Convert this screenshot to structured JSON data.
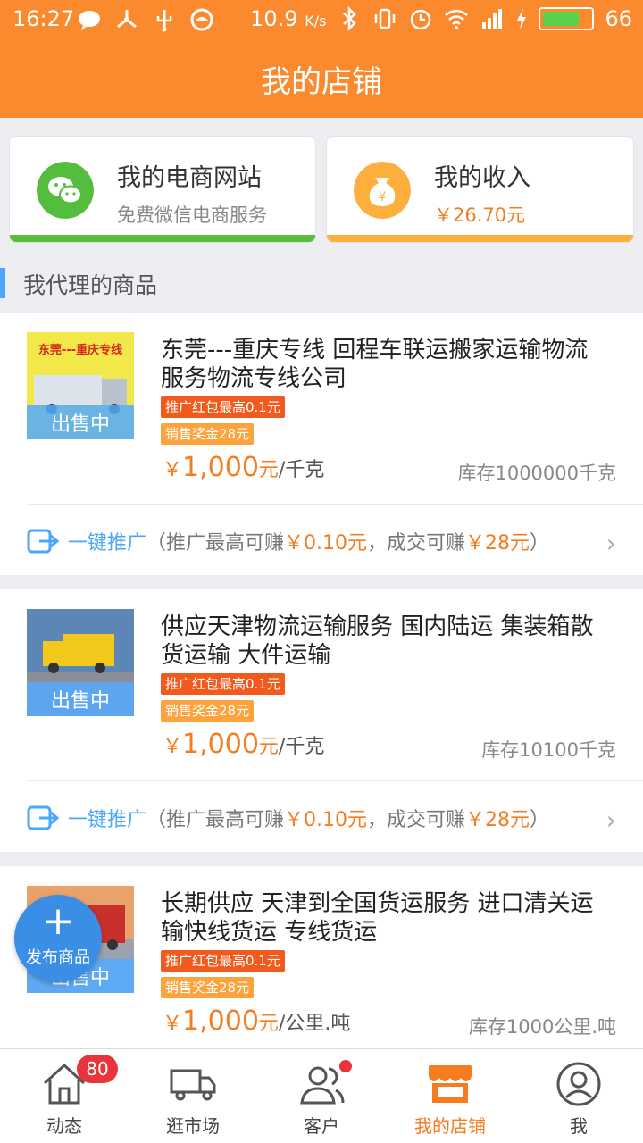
{
  "statusbar": {
    "time": "16:27",
    "speed": "10.9",
    "speed_unit": "K/s",
    "battery": "66"
  },
  "title": "我的店铺",
  "cards": {
    "site": {
      "title": "我的电商网站",
      "subtitle": "免费微信电商服务",
      "accent": "#55bd3e"
    },
    "income": {
      "title": "我的收入",
      "subtitle": "￥26.70元",
      "accent": "#fdae3c"
    }
  },
  "section_title": "我代理的商品",
  "products": [
    {
      "name": "东莞---重庆专线 回程车联运搬家运输物流服务物流专线公司",
      "thumb_text": "东莞---重庆专线",
      "status": "出售中",
      "tag_redpacket": "推广红包最高0.1元",
      "tag_bonus": "销售奖金28元",
      "price_symbol": "￥",
      "price": "1,000",
      "price_suffix": "元",
      "price_unit": "/千克",
      "stock": "库存1000000千克",
      "promo_label": "一键推广",
      "promo_text_a": "（推广最高可赚",
      "promo_amount_a": "￥0.10元",
      "promo_text_b": "，成交可赚",
      "promo_amount_b": "￥28元",
      "promo_text_c": "）"
    },
    {
      "name": "供应天津物流运输服务 国内陆运 集装箱散货运输 大件运输",
      "thumb_text": "",
      "status": "出售中",
      "tag_redpacket": "推广红包最高0.1元",
      "tag_bonus": "销售奖金28元",
      "price_symbol": "￥",
      "price": "1,000",
      "price_suffix": "元",
      "price_unit": "/千克",
      "stock": "库存10100千克",
      "promo_label": "一键推广",
      "promo_text_a": "（推广最高可赚",
      "promo_amount_a": "￥0.10元",
      "promo_text_b": "，成交可赚",
      "promo_amount_b": "￥28元",
      "promo_text_c": "）"
    },
    {
      "name": "长期供应 天津到全国货运服务 进口清关运输快线货运 专线货运",
      "thumb_text": "",
      "status": "出售中",
      "tag_redpacket": "推广红包最高0.1元",
      "tag_bonus": "销售奖金28元",
      "price_symbol": "￥",
      "price": "1,000",
      "price_suffix": "元",
      "price_unit": "/公里.吨",
      "stock": "库存1000公里.吨"
    }
  ],
  "fab_label": "发布商品",
  "tabs": [
    {
      "label": "动态",
      "badge": "80",
      "icon": "home-icon"
    },
    {
      "label": "逛市场",
      "icon": "truck-icon"
    },
    {
      "label": "客户",
      "icon": "customers-icon"
    },
    {
      "label": "我的店铺",
      "icon": "store-icon",
      "active": true
    },
    {
      "label": "我",
      "icon": "profile-icon"
    }
  ],
  "colors": {
    "brand": "#fb8a2e",
    "price": "#f57c1f",
    "link": "#4aa6ff"
  }
}
